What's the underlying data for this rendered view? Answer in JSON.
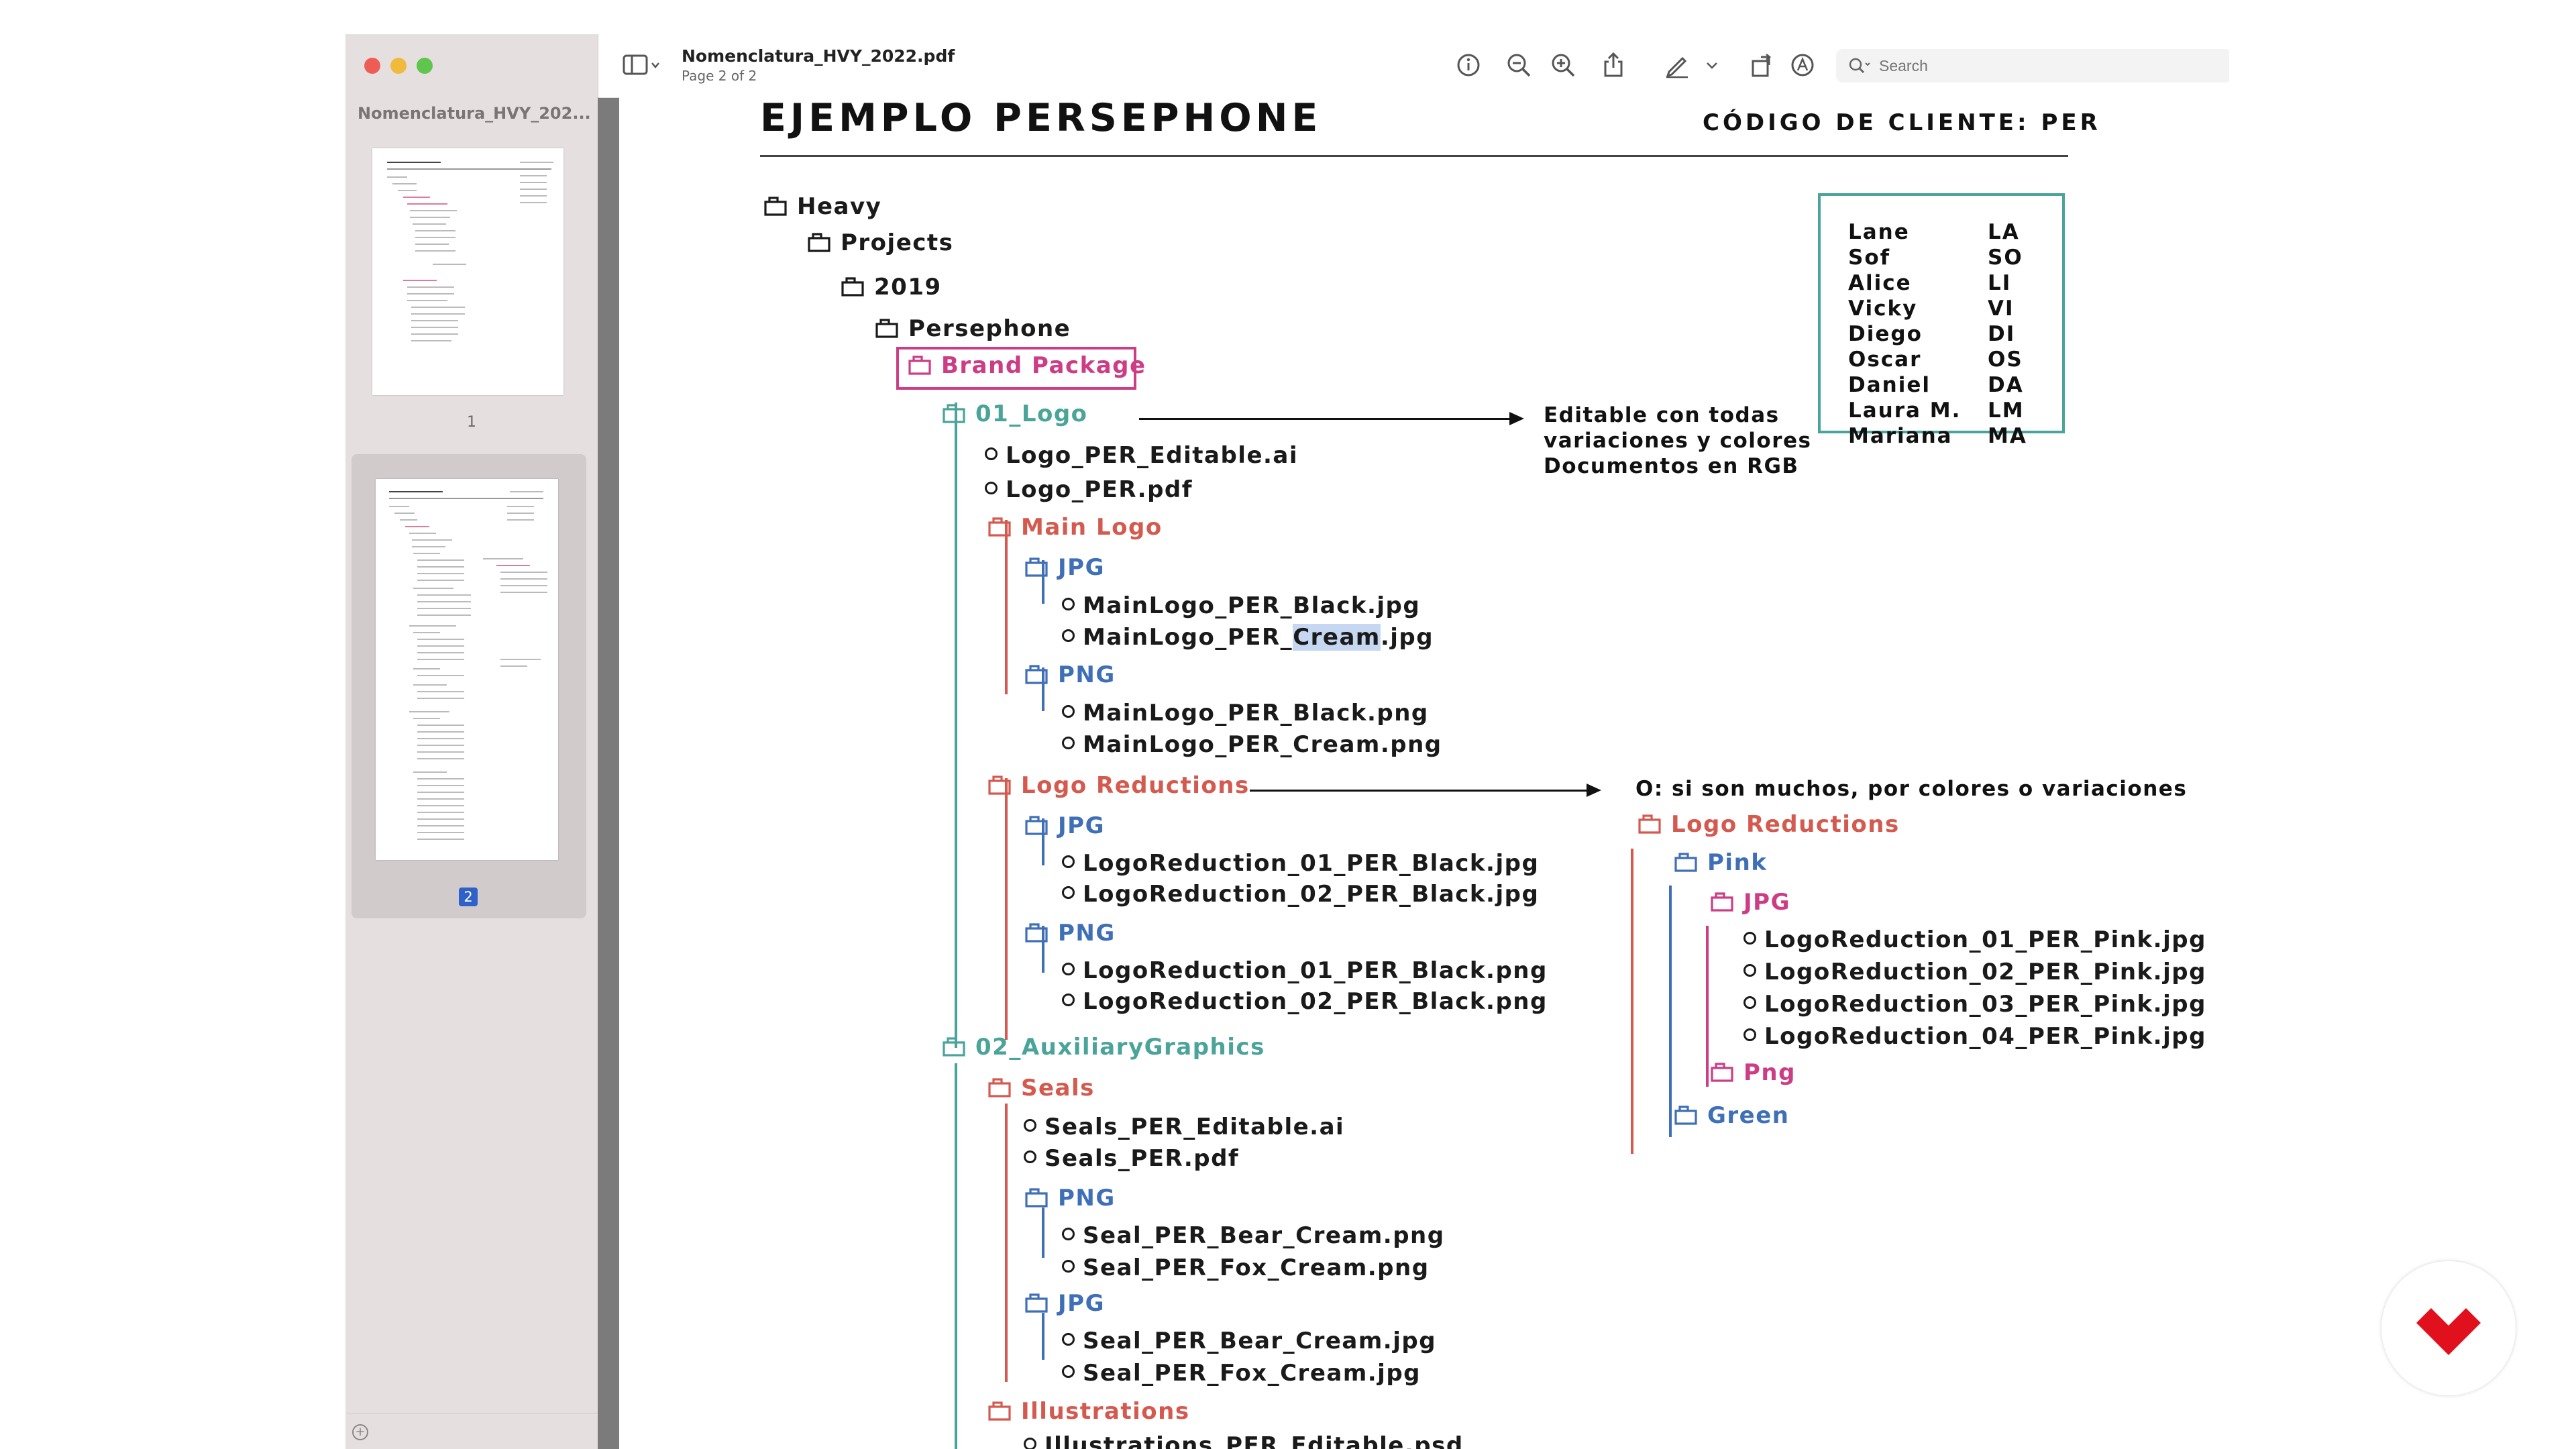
{
  "window": {
    "doc_title": "Nomenclatura_HVY_2022.pdf",
    "page_indicator": "Page 2 of 2",
    "search_placeholder": "Search"
  },
  "sidebar": {
    "doc_title": "Nomenclatura_HVY_202...",
    "thumbnails": [
      {
        "label": "1"
      },
      {
        "label": "2"
      }
    ],
    "selected_page": "2"
  },
  "toolbar": {
    "icons": [
      "sidebar-toggle-icon",
      "info-icon",
      "zoom-out-icon",
      "zoom-in-icon",
      "share-icon",
      "markup-pen-icon",
      "chevron-down-icon",
      "rotate-icon",
      "annotate-icon",
      "search-icon"
    ]
  },
  "document": {
    "title": "EJEMPLO PERSEPHONE",
    "client_code": "CÓDIGO DE CLIENTE: PER",
    "tree": {
      "heavy": "Heavy",
      "projects": "Projects",
      "year": "2019",
      "persephone": "Persephone",
      "brand_package": "Brand Package",
      "logo_folder": "01_Logo",
      "logo_editable": "Logo_PER_Editable.ai",
      "logo_pdf": "Logo_PER.pdf",
      "main_logo": "Main Logo",
      "jpg": "JPG",
      "main_black_jpg": "MainLogo_PER_Black.jpg",
      "main_cream_jpg_pre": "MainLogo_PER_",
      "main_cream_jpg_hl": "Cream",
      "main_cream_jpg_post": ".jpg",
      "png": "PNG",
      "main_black_png": "MainLogo_PER_Black.png",
      "main_cream_png": "MainLogo_PER_Cream.png",
      "logo_reductions": "Logo Reductions",
      "lr_01_jpg": "LogoReduction_01_PER_Black.jpg",
      "lr_02_jpg": "LogoReduction_02_PER_Black.jpg",
      "lr_01_png": "LogoReduction_01_PER_Black.png",
      "lr_02_png": "LogoReduction_02_PER_Black.png",
      "aux_folder": "02_AuxiliaryGraphics",
      "seals": "Seals",
      "seals_editable": "Seals_PER_Editable.ai",
      "seals_pdf": "Seals_PER.pdf",
      "seal_bear_png": "Seal_PER_Bear_Cream.png",
      "seal_fox_png": "Seal_PER_Fox_Cream.png",
      "seal_bear_jpg": "Seal_PER_Bear_Cream.jpg",
      "seal_fox_jpg": "Seal_PER_Fox_Cream.jpg",
      "illustrations": "Illustrations",
      "illustrations_psd": "Illustrations_PER_Editable.psd"
    },
    "note_logo": [
      "Editable con todas",
      "variaciones y colores",
      "Documentos en RGB"
    ],
    "note_reductions": "O: si son muchos, por colores o variaciones",
    "alt_tree": {
      "logo_reductions": "Logo Reductions",
      "pink": "Pink",
      "jpg": "JPG",
      "files": [
        "LogoReduction_01_PER_Pink.jpg",
        "LogoReduction_02_PER_Pink.jpg",
        "LogoReduction_03_PER_Pink.jpg",
        "LogoReduction_04_PER_Pink.jpg"
      ],
      "png": "Png",
      "green": "Green"
    },
    "clients": [
      {
        "name": "Lane",
        "code": "LA"
      },
      {
        "name": "Sof",
        "code": "SO"
      },
      {
        "name": "Alice",
        "code": "LI"
      },
      {
        "name": "Vicky",
        "code": "VI"
      },
      {
        "name": "Diego",
        "code": "DI"
      },
      {
        "name": "Oscar",
        "code": "OS"
      },
      {
        "name": "Daniel",
        "code": "DA"
      },
      {
        "name": "Laura M.",
        "code": "LM"
      },
      {
        "name": "Mariana",
        "code": "MA"
      }
    ]
  },
  "colors": {
    "teal": "#4aa49a",
    "red": "#d45a4f",
    "blue": "#3f6fb6",
    "pink": "#cc3d86",
    "brand_red": "#e0101c"
  }
}
